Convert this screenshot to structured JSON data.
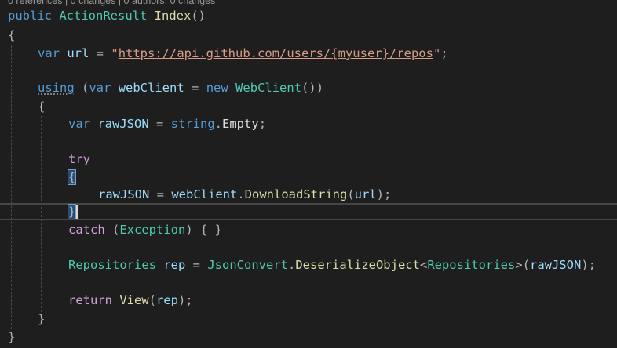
{
  "codelens": "0 references | 0 changes | 0 authors, 0 changes",
  "code": {
    "l1": {
      "kw": "public",
      "type": "ActionResult",
      "method": "Index",
      "rest": "()"
    },
    "l2": {
      "brace": "{"
    },
    "l3": {
      "kw": "var",
      "name": "url",
      "eq": " = ",
      "q1": "\"",
      "url": "https://api.github.com/users/{myuser}/repos",
      "q2": "\"",
      "end": ";"
    },
    "l4": {
      "kw_using": "using",
      "open": " (",
      "kw_var": "var",
      "name": "webClient",
      "eq": " = ",
      "kw_new": "new",
      "type": "WebClient",
      "end": "())"
    },
    "l5": {
      "brace": "{"
    },
    "l6": {
      "kw": "var",
      "name": "rawJSON",
      "eq": " = ",
      "type": "string",
      "dot": ".",
      "member": "Empty",
      "end": ";"
    },
    "l7": {
      "kw": "try"
    },
    "l8": {
      "brace": "{"
    },
    "l9": {
      "name": "rawJSON",
      "eq": " = ",
      "obj": "webClient",
      "dot": ".",
      "method": "DownloadString",
      "open": "(",
      "arg": "url",
      "end": ");"
    },
    "l10": {
      "brace": "}"
    },
    "l11": {
      "kw": "catch",
      "open": " (",
      "type": "Exception",
      "end": ") { }"
    },
    "l12": {
      "type": "Repositories",
      "name": "rep",
      "eq": " = ",
      "cls": "JsonConvert",
      "dot": ".",
      "method": "DeserializeObject",
      "lt": "<",
      "generic": "Repositories",
      "gt": ">",
      "open": "(",
      "arg": "rawJSON",
      "end": ");"
    },
    "l13": {
      "kw": "return",
      "method": "View",
      "open": "(",
      "arg": "rep",
      "end": ");"
    },
    "l14": {
      "brace": "}"
    },
    "l15": {
      "brace": "}"
    }
  }
}
